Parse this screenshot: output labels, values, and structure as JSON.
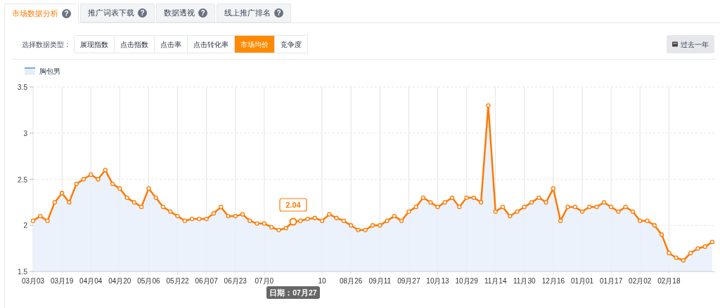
{
  "tabs": [
    {
      "label": "市场数据分析",
      "help": "?",
      "selected": true
    },
    {
      "label": "推广词表下载",
      "help": "?",
      "selected": false
    },
    {
      "label": "数据透视",
      "help": "?",
      "selected": false
    },
    {
      "label": "线上推广排名",
      "help": "?",
      "selected": false
    }
  ],
  "filter": {
    "label": "选择数据类型：",
    "options": [
      {
        "label": "展现指数",
        "selected": false
      },
      {
        "label": "点击指数",
        "selected": false
      },
      {
        "label": "点击率",
        "selected": false
      },
      {
        "label": "点击转化率",
        "selected": false
      },
      {
        "label": "市场均价",
        "selected": true
      },
      {
        "label": "竞争度",
        "selected": false
      }
    ],
    "period_button": "过去一年"
  },
  "chart": {
    "tooltip": {
      "date": "日期：07月27"
    },
    "chart_data": {
      "type": "area",
      "ylim": [
        1.5,
        3.5
      ],
      "yticks": [
        {
          "value": 1.5,
          "label": "1.5"
        },
        {
          "value": 2,
          "label": "2"
        },
        {
          "value": 2.5,
          "label": "2.5"
        },
        {
          "value": 3,
          "label": "3"
        },
        {
          "value": 3.5,
          "label": "3.5"
        }
      ],
      "categories": [
        "03月03",
        null,
        null,
        null,
        "03月19",
        null,
        null,
        null,
        "04月04",
        null,
        null,
        null,
        "04月20",
        null,
        null,
        null,
        "05月06",
        null,
        null,
        null,
        "05月22",
        null,
        null,
        null,
        "06月07",
        null,
        null,
        null,
        "06月23",
        null,
        null,
        null,
        "07月0",
        null,
        null,
        null,
        null,
        null,
        null,
        null,
        "10",
        null,
        null,
        null,
        "08月26",
        null,
        null,
        null,
        "09月11",
        null,
        null,
        null,
        "09月27",
        null,
        null,
        null,
        "10月13",
        null,
        null,
        null,
        "10月29",
        null,
        null,
        null,
        "11月14",
        null,
        null,
        null,
        "11月30",
        null,
        null,
        null,
        "12月16",
        null,
        null,
        null,
        "01月01",
        null,
        null,
        null,
        "01月17",
        null,
        null,
        null,
        "02月02",
        null,
        null,
        null,
        "02月18",
        null,
        null,
        null,
        null,
        null,
        null
      ],
      "series": [
        {
          "name": "胸包男",
          "color": "#ff7a00",
          "values": [
            2.05,
            2.1,
            2.05,
            2.25,
            2.35,
            2.25,
            2.45,
            2.5,
            2.55,
            2.5,
            2.6,
            2.45,
            2.4,
            2.3,
            2.25,
            2.2,
            2.4,
            2.3,
            2.2,
            2.15,
            2.1,
            2.05,
            2.07,
            2.07,
            2.07,
            2.13,
            2.2,
            2.1,
            2.1,
            2.12,
            2.05,
            2.02,
            2.02,
            1.98,
            1.95,
            1.97,
            2.04,
            2.05,
            2.07,
            2.08,
            2.05,
            2.12,
            2.08,
            2.05,
            2.0,
            1.95,
            1.95,
            2.0,
            2.0,
            2.05,
            2.1,
            2.05,
            2.15,
            2.2,
            2.3,
            2.25,
            2.2,
            2.25,
            2.3,
            2.2,
            2.3,
            2.3,
            2.25,
            3.3,
            2.15,
            2.2,
            2.1,
            2.15,
            2.2,
            2.25,
            2.3,
            2.25,
            2.4,
            2.05,
            2.2,
            2.2,
            2.15,
            2.2,
            2.2,
            2.25,
            2.2,
            2.15,
            2.2,
            2.15,
            2.05,
            2.05,
            2.0,
            1.9,
            1.7,
            1.65,
            1.62,
            1.7,
            1.75,
            1.77,
            1.82
          ]
        }
      ],
      "grid": true,
      "annotations": [
        {
          "y": 2.04,
          "text": "2.04"
        }
      ]
    }
  }
}
